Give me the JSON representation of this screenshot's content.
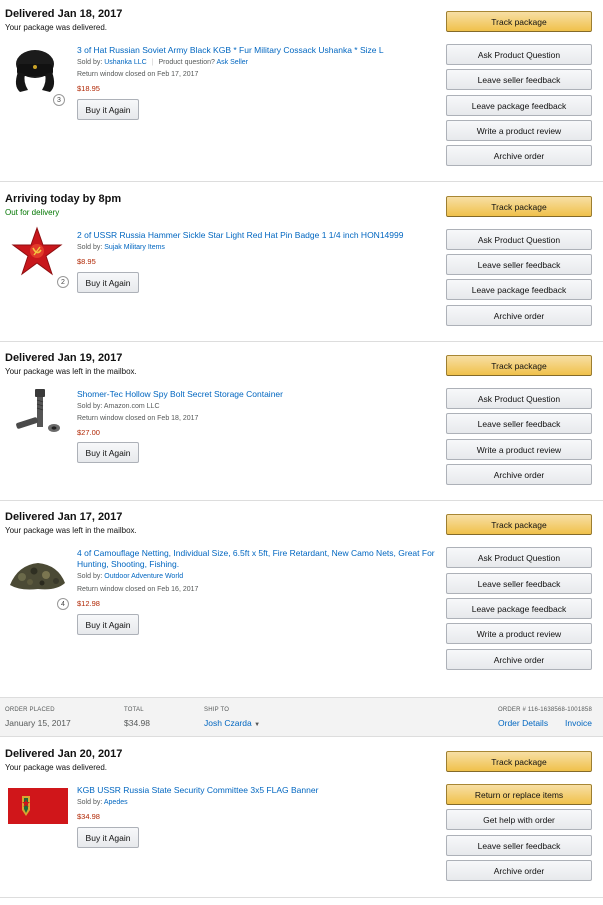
{
  "shipments": [
    {
      "status": "Delivered Jan 18, 2017",
      "status_detail": "Your package was delivered.",
      "item_title": "3 of Hat Russian Soviet Army Black KGB * Fur Military Cossack Ushanka * Size L",
      "sold_by_label": "Sold by:",
      "seller": "Ushanka LLC",
      "question_text": "Product question?",
      "ask_seller": "Ask Seller",
      "return_window": "Return window closed on Feb 17, 2017",
      "price": "$18.95",
      "qty": "3",
      "buy_again": "Buy it Again",
      "buttons": [
        "Track package",
        "Ask Product Question",
        "Leave seller feedback",
        "Leave package feedback",
        "Write a product review",
        "Archive order"
      ]
    },
    {
      "status": "Arriving today by 8pm",
      "status_detail": "Out for delivery",
      "item_title": "2 of USSR Russia Hammer Sickle Star Light Red Hat Pin Badge 1 1/4 inch HON14999",
      "sold_by_label": "Sold by:",
      "seller": "Sujak Military Items",
      "price": "$8.95",
      "qty": "2",
      "buy_again": "Buy it Again",
      "buttons": [
        "Track package",
        "Ask Product Question",
        "Leave seller feedback",
        "Leave package feedback",
        "Archive order"
      ]
    },
    {
      "status": "Delivered Jan 19, 2017",
      "status_detail": "Your package was left in the mailbox.",
      "item_title": "Shomer-Tec Hollow Spy Bolt Secret Storage Container",
      "sold_by_label": "Sold by:",
      "seller": "Amazon.com LLC",
      "return_window": "Return window closed on Feb 18, 2017",
      "price": "$27.00",
      "buy_again": "Buy it Again",
      "buttons": [
        "Track package",
        "Ask Product Question",
        "Leave seller feedback",
        "Write a product review",
        "Archive order"
      ]
    },
    {
      "status": "Delivered Jan 17, 2017",
      "status_detail": "Your package was left in the mailbox.",
      "item_title": "4 of Camouflage Netting, Individual Size, 6.5ft x 5ft, Fire Retardant, New Camo Nets, Great For Hunting, Shooting, Fishing.",
      "sold_by_label": "Sold by:",
      "seller": "Outdoor Adventure World",
      "return_window": "Return window closed on Feb 16, 2017",
      "price": "$12.98",
      "qty": "4",
      "buy_again": "Buy it Again",
      "buttons": [
        "Track package",
        "Ask Product Question",
        "Leave seller feedback",
        "Leave package feedback",
        "Write a product review",
        "Archive order"
      ]
    },
    {
      "status": "Delivered Jan 20, 2017",
      "status_detail": "Your package was delivered.",
      "item_title": "KGB USSR Russia State Security Committee 3x5 FLAG Banner",
      "sold_by_label": "Sold by:",
      "seller": "Apedes",
      "price": "$34.98",
      "buy_again": "Buy it Again",
      "buttons": [
        "Track package",
        "Return or replace items",
        "Get help with order",
        "Leave seller feedback",
        "Archive order"
      ]
    }
  ],
  "order_header": {
    "placed_label": "ORDER PLACED",
    "placed_value": "January 15, 2017",
    "total_label": "TOTAL",
    "total_value": "$34.98",
    "ship_label": "SHIP TO",
    "ship_value": "Josh Czarda",
    "order_number": "ORDER # 116-1638568-1001858",
    "order_details": "Order Details",
    "invoice": "Invoice"
  },
  "colors": {
    "link": "#0066c0",
    "price": "#b12704",
    "green_status": "#007600",
    "track_button": "#f0c14b"
  }
}
